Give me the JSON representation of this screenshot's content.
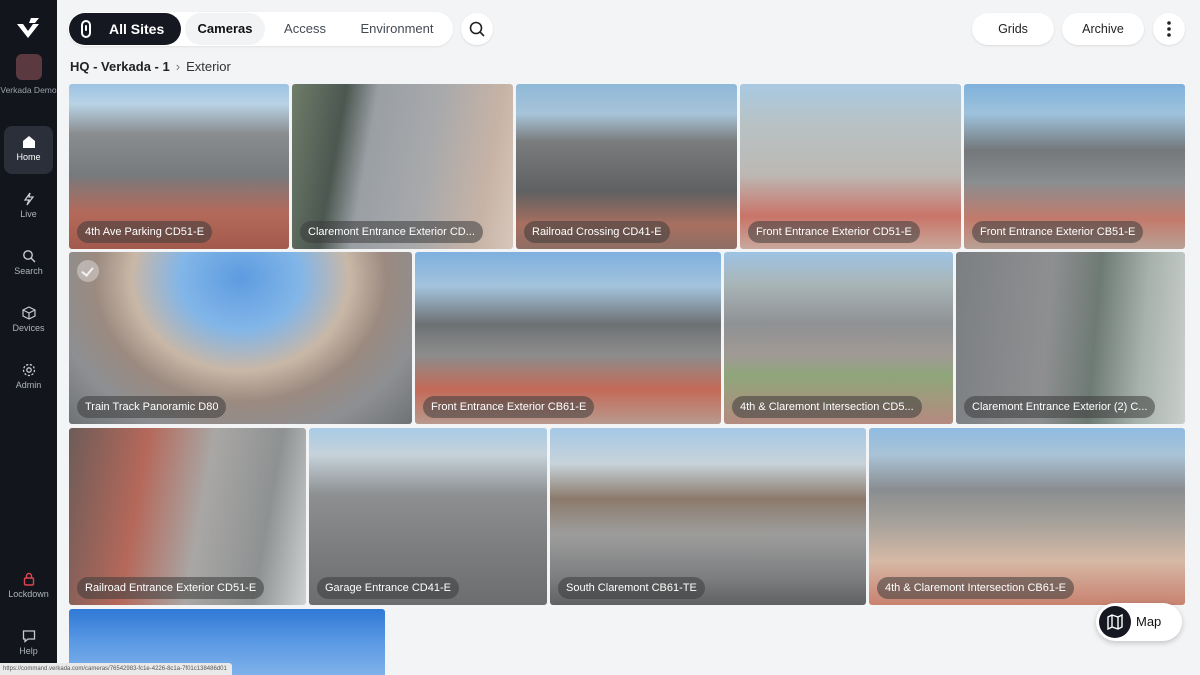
{
  "sidebar": {
    "org_name": "Verkada Demo",
    "items": [
      {
        "id": "home",
        "label": "Home",
        "icon": "home-icon",
        "active": true
      },
      {
        "id": "live",
        "label": "Live",
        "icon": "bolt-icon",
        "active": false
      },
      {
        "id": "search",
        "label": "Search",
        "icon": "search-icon",
        "active": false
      },
      {
        "id": "devices",
        "label": "Devices",
        "icon": "cube-icon",
        "active": false
      },
      {
        "id": "admin",
        "label": "Admin",
        "icon": "gear-icon",
        "active": false
      }
    ],
    "bottom": [
      {
        "id": "lockdown",
        "label": "Lockdown",
        "icon": "lock-icon"
      },
      {
        "id": "help",
        "label": "Help",
        "icon": "chat-icon"
      }
    ]
  },
  "topbar": {
    "all_sites_label": "All Sites",
    "tabs": [
      {
        "label": "Cameras",
        "selected": true
      },
      {
        "label": "Access",
        "selected": false
      },
      {
        "label": "Environment",
        "selected": false
      }
    ],
    "grids_label": "Grids",
    "archive_label": "Archive"
  },
  "breadcrumb": {
    "site": "HQ - Verkada - 1",
    "current": "Exterior"
  },
  "cameras": [
    {
      "name": "4th Ave Parking CD51-E"
    },
    {
      "name": "Claremont Entrance Exterior CD..."
    },
    {
      "name": "Railroad Crossing CD41-E"
    },
    {
      "name": "Front Entrance Exterior CD51-E"
    },
    {
      "name": "Front Entrance Exterior CB51-E"
    },
    {
      "name": "Train Track Panoramic D80"
    },
    {
      "name": "Front Entrance Exterior CB61-E"
    },
    {
      "name": "4th & Claremont Intersection CD5..."
    },
    {
      "name": "Claremont Entrance Exterior (2) C..."
    },
    {
      "name": "Railroad Entrance Exterior CD51-E"
    },
    {
      "name": "Garage Entrance CD41-E"
    },
    {
      "name": "South Claremont CB61-TE"
    },
    {
      "name": "4th & Claremont Intersection CB61-E"
    }
  ],
  "map_label": "Map",
  "status_url": "https://command.verkada.com/cameras/76542983-fc1e-4226-8c1a-7f01c138486d01",
  "colors": {
    "sidebar_bg": "#12151c",
    "accent_dark": "#151821",
    "page_bg": "#f3f4f6"
  }
}
